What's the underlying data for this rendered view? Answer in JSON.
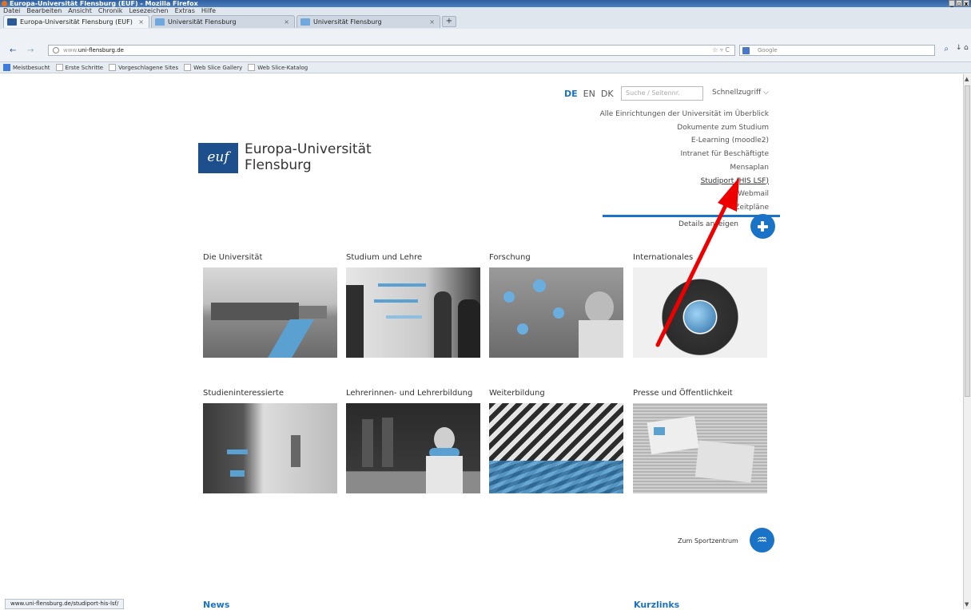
{
  "window": {
    "title": "Europa-Universität Flensburg (EUF) - Mozilla Firefox",
    "controls": [
      "_",
      "▫",
      "x"
    ]
  },
  "menu": [
    "Datei",
    "Bearbeiten",
    "Ansicht",
    "Chronik",
    "Lesezeichen",
    "Extras",
    "Hilfe"
  ],
  "tabs": [
    {
      "label": "Europa-Universität Flensburg (EUF)",
      "close": "×"
    },
    {
      "label": "Universität Flensburg",
      "close": "×"
    },
    {
      "label": "Universität Flensburg",
      "close": "×"
    }
  ],
  "newtab": "+",
  "nav": {
    "back": "←",
    "forward": "→",
    "url_prefix": "www.",
    "url_domain": "uni-flensburg.de",
    "url_controls": "☆ ▿ C",
    "search_placeholder": "Google",
    "search_icon": "⌕",
    "download": "↓",
    "home": "⌂"
  },
  "bookmarks": [
    "Meistbesucht",
    "Erste Schritte",
    "Vorgeschlagene Sites",
    "Web Slice Gallery",
    "Web Slice-Katalog"
  ],
  "page": {
    "languages": [
      "DE",
      "EN",
      "DK"
    ],
    "search_placeholder": "Suche / Seitennr.",
    "quickaccess": "Schnellzugriff",
    "quickaccess_arrow": "⌵",
    "quicklinks": [
      "Alle Einrichtungen der Universität im Überblick",
      "Dokumente zum Studium",
      "E-Learning (moodle2)",
      "Intranet für Beschäftigte",
      "Mensaplan",
      "Studiport (HIS LSF)",
      "Webmail",
      "Zeitpläne"
    ],
    "details": "Details anzeigen",
    "logo": {
      "mark": "euf",
      "line1": "Europa-Universität",
      "line2": "Flensburg"
    },
    "categories": [
      "Die Universität",
      "Studium und Lehre",
      "Forschung",
      "Internationales",
      "Studieninteressierte",
      "Lehrerinnen- und Lehrerbildung",
      "Weiterbildung",
      "Presse und Öffentlichkeit"
    ],
    "sport": "Zum Sportzentrum",
    "sport_icon": "♒",
    "news": "News",
    "kurzlinks": "Kurzlinks"
  },
  "status": "www.uni-flensburg.de/studiport-his-lsf/",
  "annotation_color": "#ee0000",
  "accent": "#1a73c7"
}
